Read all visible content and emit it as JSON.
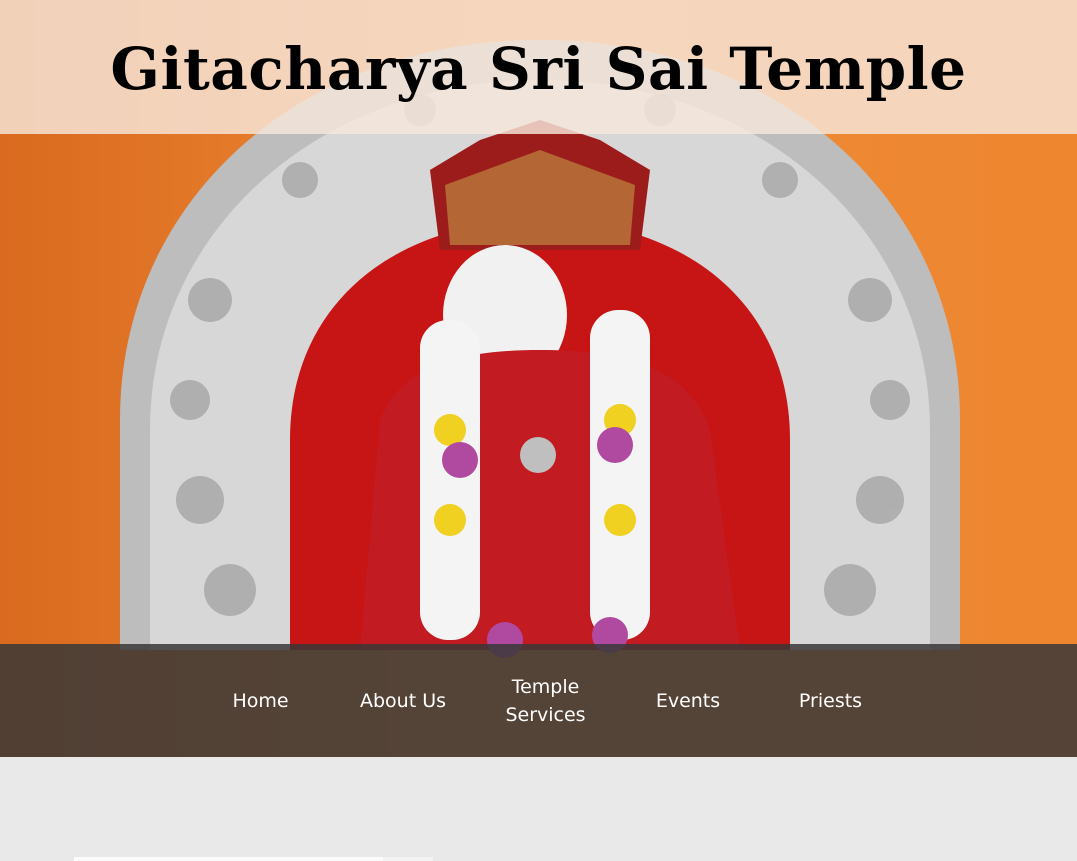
{
  "site": {
    "title": "Gitacharya Sri Sai Temple"
  },
  "nav": {
    "items": [
      {
        "label": "Home"
      },
      {
        "label": "About Us"
      },
      {
        "label_line1": "Temple",
        "label_line2": "Services"
      },
      {
        "label": "Events"
      },
      {
        "label": "Priests"
      }
    ]
  },
  "colors": {
    "nav_background": "#3a3838",
    "title_band": "#f6e8dc",
    "page_background": "#e9e9e9",
    "hero_background": "#ee8630"
  }
}
